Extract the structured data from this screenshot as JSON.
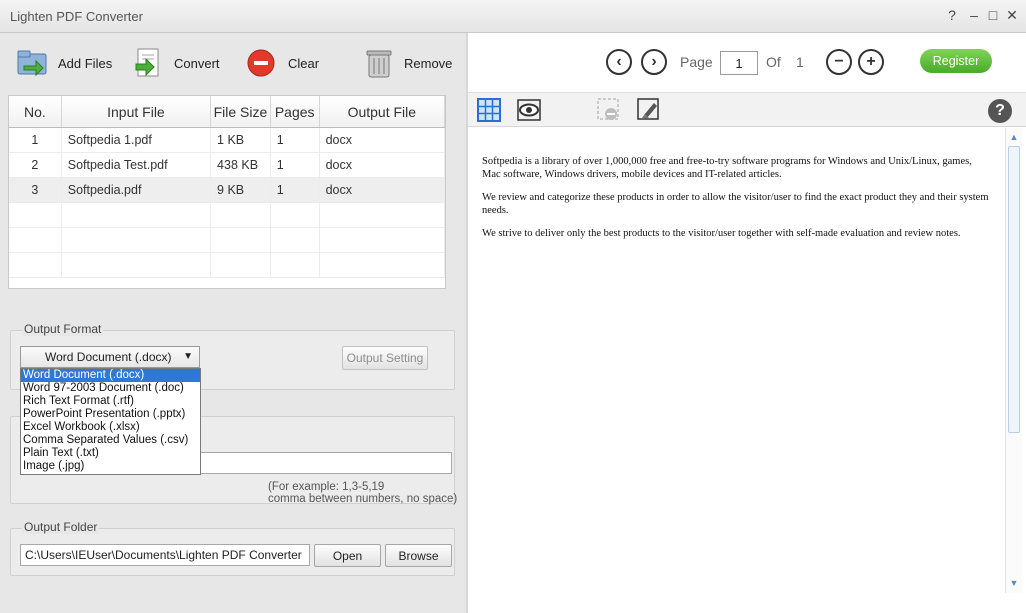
{
  "window": {
    "title": "Lighten PDF Converter",
    "controls": [
      "?",
      "–",
      "□",
      "✕"
    ]
  },
  "toolbar": {
    "add_files": "Add Files",
    "convert": "Convert",
    "clear": "Clear",
    "remove": "Remove"
  },
  "table": {
    "columns": [
      "No.",
      "Input File",
      "File Size",
      "Pages",
      "Output File"
    ],
    "rows": [
      {
        "no": "1",
        "file": "Softpedia 1.pdf",
        "size": "1 KB",
        "pages": "1",
        "output": "docx"
      },
      {
        "no": "2",
        "file": "Softpedia Test.pdf",
        "size": "438 KB",
        "pages": "1",
        "output": "docx"
      },
      {
        "no": "3",
        "file": "Softpedia.pdf",
        "size": "9 KB",
        "pages": "1",
        "output": "docx"
      }
    ]
  },
  "output_format": {
    "label": "Output Format",
    "selected": "Word Document (.docx)",
    "setting_button": "Output Setting",
    "options": [
      "Word Document (.docx)",
      "Word 97-2003 Document (.doc)",
      "Rich Text Format (.rtf)",
      "PowerPoint Presentation (.pptx)",
      "Excel Workbook (.xlsx)",
      "Comma Separated Values (.csv)",
      "Plain Text (.txt)",
      "Image (.jpg)"
    ]
  },
  "pages": {
    "hint_line1": "(For example: 1,3-5,19",
    "hint_line2": "comma between numbers, no space)"
  },
  "output_folder": {
    "label": "Output Folder",
    "path": "C:\\Users\\IEUser\\Documents\\Lighten PDF Converter",
    "open": "Open",
    "browse": "Browse"
  },
  "viewer": {
    "page_label": "Page",
    "page_value": "1",
    "of_label": "Of",
    "total_pages": "1",
    "register": "Register",
    "help": "?",
    "paragraphs": [
      "Softpedia is a library of over 1,000,000 free and free-to-try software programs for Windows and Unix/Linux, games, Mac software, Windows drivers, mobile devices and IT-related articles.",
      "We review and categorize these products in order to allow the visitor/user to find the exact product they and their system needs.",
      "We strive to deliver only the best products to the visitor/user together with self-made evaluation and review notes."
    ]
  },
  "colors": {
    "accent": "#3078d8",
    "register_green": "#5cbf35",
    "clear_red": "#e03a2a"
  }
}
